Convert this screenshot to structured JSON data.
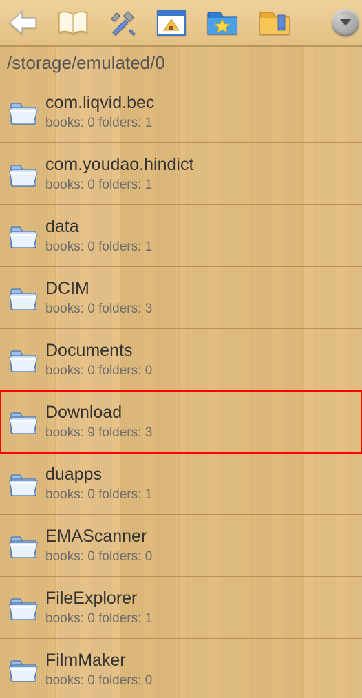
{
  "path": "/storage/emulated/0",
  "toolbar": {
    "back": "back",
    "library": "library",
    "tools": "tools",
    "home": "home",
    "favorites": "favorites",
    "bookmarks": "bookmarks",
    "menu": "menu"
  },
  "metaPrefix": {
    "books": "books:",
    "folders": "folders:"
  },
  "folders": [
    {
      "name": "com.liqvid.bec",
      "books": 0,
      "folders": 1,
      "highlight": false
    },
    {
      "name": "com.youdao.hindict",
      "books": 0,
      "folders": 1,
      "highlight": false
    },
    {
      "name": "data",
      "books": 0,
      "folders": 1,
      "highlight": false
    },
    {
      "name": "DCIM",
      "books": 0,
      "folders": 3,
      "highlight": false
    },
    {
      "name": "Documents",
      "books": 0,
      "folders": 0,
      "highlight": false
    },
    {
      "name": "Download",
      "books": 9,
      "folders": 3,
      "highlight": true
    },
    {
      "name": "duapps",
      "books": 0,
      "folders": 1,
      "highlight": false
    },
    {
      "name": "EMAScanner",
      "books": 0,
      "folders": 0,
      "highlight": false
    },
    {
      "name": "FileExplorer",
      "books": 0,
      "folders": 1,
      "highlight": false
    },
    {
      "name": "FilmMaker",
      "books": 0,
      "folders": 0,
      "highlight": false
    }
  ]
}
